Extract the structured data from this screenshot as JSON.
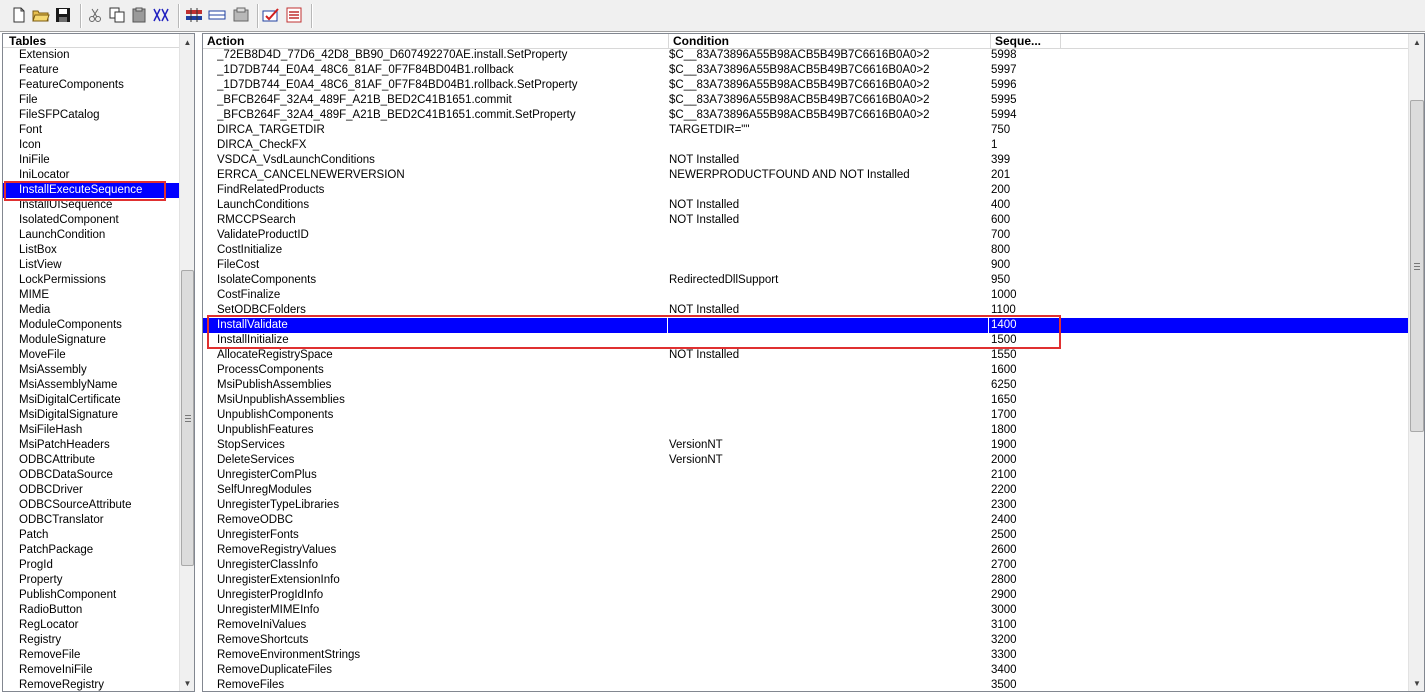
{
  "toolbar": {
    "buttons": [
      {
        "name": "new-icon"
      },
      {
        "name": "open-folder-icon"
      },
      {
        "name": "save-icon"
      },
      {
        "name": "cut-icon"
      },
      {
        "name": "copy-icon"
      },
      {
        "name": "paste-icon"
      },
      {
        "name": "find-icon"
      },
      {
        "name": "tables-icon"
      },
      {
        "name": "rows-icon"
      },
      {
        "name": "import-icon"
      },
      {
        "name": "validate-icon"
      },
      {
        "name": "properties-icon"
      }
    ]
  },
  "tables_pane": {
    "header": "Tables",
    "items": [
      "Extension",
      "Feature",
      "FeatureComponents",
      "File",
      "FileSFPCatalog",
      "Font",
      "Icon",
      "IniFile",
      "IniLocator",
      "InstallExecuteSequence",
      "InstallUISequence",
      "IsolatedComponent",
      "LaunchCondition",
      "ListBox",
      "ListView",
      "LockPermissions",
      "MIME",
      "Media",
      "ModuleComponents",
      "ModuleSignature",
      "MoveFile",
      "MsiAssembly",
      "MsiAssemblyName",
      "MsiDigitalCertificate",
      "MsiDigitalSignature",
      "MsiFileHash",
      "MsiPatchHeaders",
      "ODBCAttribute",
      "ODBCDataSource",
      "ODBCDriver",
      "ODBCSourceAttribute",
      "ODBCTranslator",
      "Patch",
      "PatchPackage",
      "ProgId",
      "Property",
      "PublishComponent",
      "RadioButton",
      "RegLocator",
      "Registry",
      "RemoveFile",
      "RemoveIniFile",
      "RemoveRegistry"
    ],
    "selected_index": 9
  },
  "grid": {
    "columns": [
      "Action",
      "Condition",
      "Seque..."
    ],
    "selected_row": 18,
    "rows": [
      [
        "_72EB8D4D_77D6_42D8_BB90_D607492270AE.install.SetProperty",
        "$C__83A73896A55B98ACB5B49B7C6616B0A0>2",
        "5998"
      ],
      [
        "_1D7DB744_E0A4_48C6_81AF_0F7F84BD04B1.rollback",
        "$C__83A73896A55B98ACB5B49B7C6616B0A0>2",
        "5997"
      ],
      [
        "_1D7DB744_E0A4_48C6_81AF_0F7F84BD04B1.rollback.SetProperty",
        "$C__83A73896A55B98ACB5B49B7C6616B0A0>2",
        "5996"
      ],
      [
        "_BFCB264F_32A4_489F_A21B_BED2C41B1651.commit",
        "$C__83A73896A55B98ACB5B49B7C6616B0A0>2",
        "5995"
      ],
      [
        "_BFCB264F_32A4_489F_A21B_BED2C41B1651.commit.SetProperty",
        "$C__83A73896A55B98ACB5B49B7C6616B0A0>2",
        "5994"
      ],
      [
        "DIRCA_TARGETDIR",
        "TARGETDIR=\"\"",
        "750"
      ],
      [
        "DIRCA_CheckFX",
        "",
        "1"
      ],
      [
        "VSDCA_VsdLaunchConditions",
        "NOT Installed",
        "399"
      ],
      [
        "ERRCA_CANCELNEWERVERSION",
        "NEWERPRODUCTFOUND AND NOT Installed",
        "201"
      ],
      [
        "FindRelatedProducts",
        "",
        "200"
      ],
      [
        "LaunchConditions",
        "NOT Installed",
        "400"
      ],
      [
        "RMCCPSearch",
        "NOT Installed",
        "600"
      ],
      [
        "ValidateProductID",
        "",
        "700"
      ],
      [
        "CostInitialize",
        "",
        "800"
      ],
      [
        "FileCost",
        "",
        "900"
      ],
      [
        "IsolateComponents",
        "RedirectedDllSupport",
        "950"
      ],
      [
        "CostFinalize",
        "",
        "1000"
      ],
      [
        "SetODBCFolders",
        "NOT Installed",
        "1100"
      ],
      [
        "InstallValidate",
        "",
        "1400"
      ],
      [
        "InstallInitialize",
        "",
        "1500"
      ],
      [
        "AllocateRegistrySpace",
        "NOT Installed",
        "1550"
      ],
      [
        "ProcessComponents",
        "",
        "1600"
      ],
      [
        "MsiPublishAssemblies",
        "",
        "6250"
      ],
      [
        "MsiUnpublishAssemblies",
        "",
        "1650"
      ],
      [
        "UnpublishComponents",
        "",
        "1700"
      ],
      [
        "UnpublishFeatures",
        "",
        "1800"
      ],
      [
        "StopServices",
        "VersionNT",
        "1900"
      ],
      [
        "DeleteServices",
        "VersionNT",
        "2000"
      ],
      [
        "UnregisterComPlus",
        "",
        "2100"
      ],
      [
        "SelfUnregModules",
        "",
        "2200"
      ],
      [
        "UnregisterTypeLibraries",
        "",
        "2300"
      ],
      [
        "RemoveODBC",
        "",
        "2400"
      ],
      [
        "UnregisterFonts",
        "",
        "2500"
      ],
      [
        "RemoveRegistryValues",
        "",
        "2600"
      ],
      [
        "UnregisterClassInfo",
        "",
        "2700"
      ],
      [
        "UnregisterExtensionInfo",
        "",
        "2800"
      ],
      [
        "UnregisterProgIdInfo",
        "",
        "2900"
      ],
      [
        "UnregisterMIMEInfo",
        "",
        "3000"
      ],
      [
        "RemoveIniValues",
        "",
        "3100"
      ],
      [
        "RemoveShortcuts",
        "",
        "3200"
      ],
      [
        "RemoveEnvironmentStrings",
        "",
        "3300"
      ],
      [
        "RemoveDuplicateFiles",
        "",
        "3400"
      ],
      [
        "RemoveFiles",
        "",
        "3500"
      ]
    ]
  }
}
